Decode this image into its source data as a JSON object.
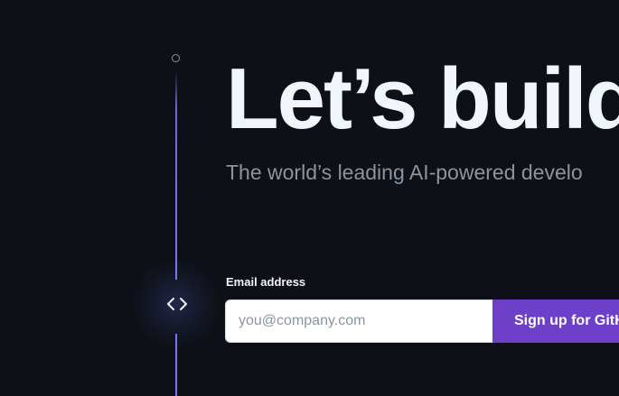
{
  "timeline": {
    "line_color": "#7b73ff",
    "icon": "code-icon"
  },
  "hero": {
    "title": "Let’s build",
    "subtitle": "The world’s leading AI-powered develo"
  },
  "form": {
    "email_label": "Email address",
    "email_placeholder": "you@company.com",
    "email_value": "",
    "submit_label": "Sign up for GitHub",
    "submit_color": "#6e40c9"
  }
}
